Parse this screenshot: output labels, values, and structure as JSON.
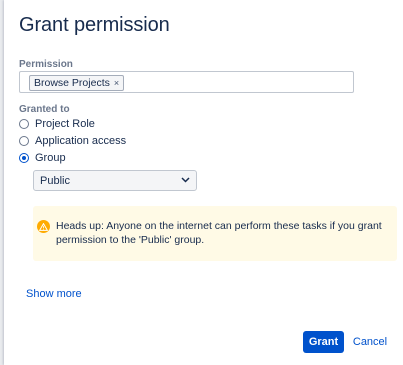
{
  "dialog": {
    "title": "Grant permission"
  },
  "permission": {
    "label": "Permission",
    "selected_tag": "Browse Projects",
    "remove_glyph": "×"
  },
  "granted_to": {
    "label": "Granted to",
    "options": [
      {
        "label": "Project Role",
        "checked": false
      },
      {
        "label": "Application access",
        "checked": false
      },
      {
        "label": "Group",
        "checked": true
      }
    ],
    "group_select": {
      "value": "Public"
    }
  },
  "warning": {
    "icon": "warning-icon",
    "text": "Heads up: Anyone on the internet can perform these tasks if you grant permission to the 'Public' group."
  },
  "links": {
    "show_more": "Show more"
  },
  "actions": {
    "grant": "Grant",
    "cancel": "Cancel"
  },
  "colors": {
    "primary": "#0052cc",
    "warning_bg": "#fffae6",
    "warning_icon": "#ffab00"
  }
}
